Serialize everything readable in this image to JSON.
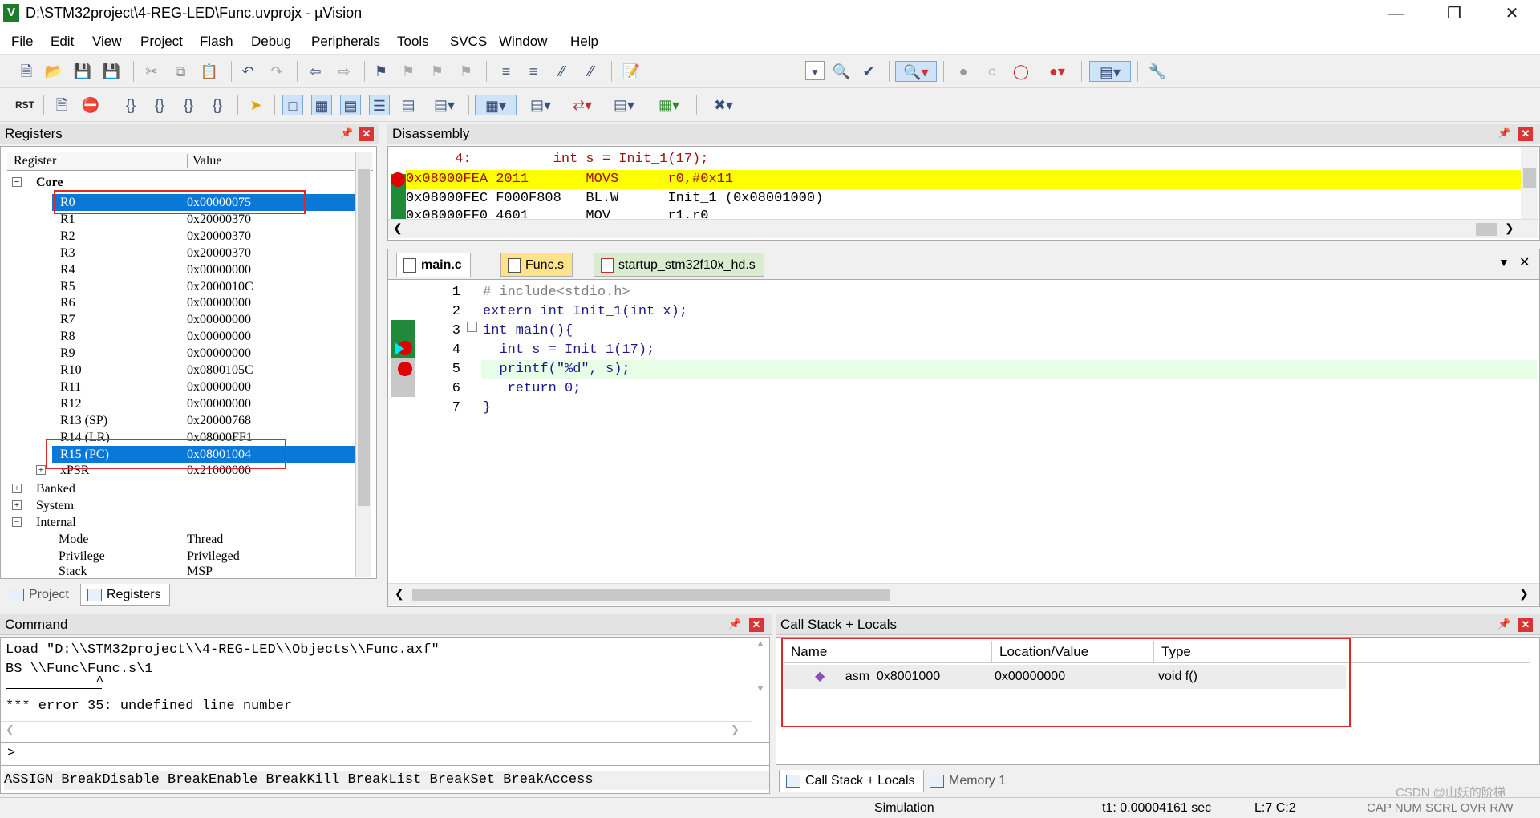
{
  "window": {
    "title": "D:\\STM32project\\4-REG-LED\\Func.uvprojx - µVision",
    "logo": "V"
  },
  "menu": [
    "File",
    "Edit",
    "View",
    "Project",
    "Flash",
    "Debug",
    "Peripherals",
    "Tools",
    "SVCS",
    "Window",
    "Help"
  ],
  "registers": {
    "title": "Registers",
    "col_register": "Register",
    "col_value": "Value",
    "core_label": "Core",
    "rows": [
      {
        "name": "R0",
        "value": "0x00000075"
      },
      {
        "name": "R1",
        "value": "0x20000370"
      },
      {
        "name": "R2",
        "value": "0x20000370"
      },
      {
        "name": "R3",
        "value": "0x20000370"
      },
      {
        "name": "R4",
        "value": "0x00000000"
      },
      {
        "name": "R5",
        "value": "0x2000010C"
      },
      {
        "name": "R6",
        "value": "0x00000000"
      },
      {
        "name": "R7",
        "value": "0x00000000"
      },
      {
        "name": "R8",
        "value": "0x00000000"
      },
      {
        "name": "R9",
        "value": "0x00000000"
      },
      {
        "name": "R10",
        "value": "0x0800105C"
      },
      {
        "name": "R11",
        "value": "0x00000000"
      },
      {
        "name": "R12",
        "value": "0x00000000"
      },
      {
        "name": "R13 (SP)",
        "value": "0x20000768"
      },
      {
        "name": "R14 (LR)",
        "value": "0x08000FF1"
      },
      {
        "name": "R15 (PC)",
        "value": "0x08001004"
      },
      {
        "name": "xPSR",
        "value": "0x21000000"
      }
    ],
    "groups": [
      "Banked",
      "System",
      "Internal"
    ],
    "internal": [
      {
        "name": "Mode",
        "value": "Thread"
      },
      {
        "name": "Privilege",
        "value": "Privileged"
      },
      {
        "name": "Stack",
        "value": "MSP"
      }
    ],
    "tab_project": "Project",
    "tab_registers": "Registers"
  },
  "disassembly": {
    "title": "Disassembly",
    "lines": [
      "      4:          int s = Init_1(17);",
      "0x08000FEA 2011       MOVS      r0,#0x11",
      "0x08000FEC F000F808   BL.W      Init_1 (0x08001000)",
      "0x08000FF0 4601       MOV       r1,r0"
    ]
  },
  "editor": {
    "tabs": [
      "main.c",
      "Func.s",
      "startup_stm32f10x_hd.s"
    ],
    "lines": [
      {
        "n": "1",
        "text": "# include<stdio.h>"
      },
      {
        "n": "2",
        "text": "extern int Init_1(int x);"
      },
      {
        "n": "3",
        "text": "int main(){"
      },
      {
        "n": "4",
        "text": "  int s = Init_1(17);"
      },
      {
        "n": "5",
        "text": "  printf(\"%d\", s);"
      },
      {
        "n": "6",
        "text": "   return 0;"
      },
      {
        "n": "7",
        "text": "}"
      }
    ]
  },
  "command": {
    "title": "Command",
    "lines": [
      "Load \"D:\\\\STM32project\\\\4-REG-LED\\\\Objects\\\\Func.axf\"",
      "BS \\\\Func\\Func.s\\1",
      "           ^",
      "*** error 35: undefined line number"
    ],
    "prompt": ">",
    "hints": "ASSIGN BreakDisable BreakEnable BreakKill BreakList BreakSet BreakAccess"
  },
  "callstack": {
    "title": "Call Stack + Locals",
    "col_name": "Name",
    "col_loc": "Location/Value",
    "col_type": "Type",
    "row": {
      "name": "__asm_0x8001000",
      "loc": "0x00000000",
      "type": "void f()"
    },
    "tab_callstack": "Call Stack + Locals",
    "tab_memory": "Memory 1"
  },
  "status": {
    "mode": "Simulation",
    "time": "t1: 0.00004161 sec",
    "pos": "L:7 C:2",
    "flags": "CAP NUM SCRL OVR R/W",
    "watermark": "CSDN @山妖的阶梯"
  },
  "colors": {
    "accent": "#0a78d7",
    "highlight": "#ffff00",
    "breakpoint": "#e00000",
    "annotation": "#e02828"
  }
}
